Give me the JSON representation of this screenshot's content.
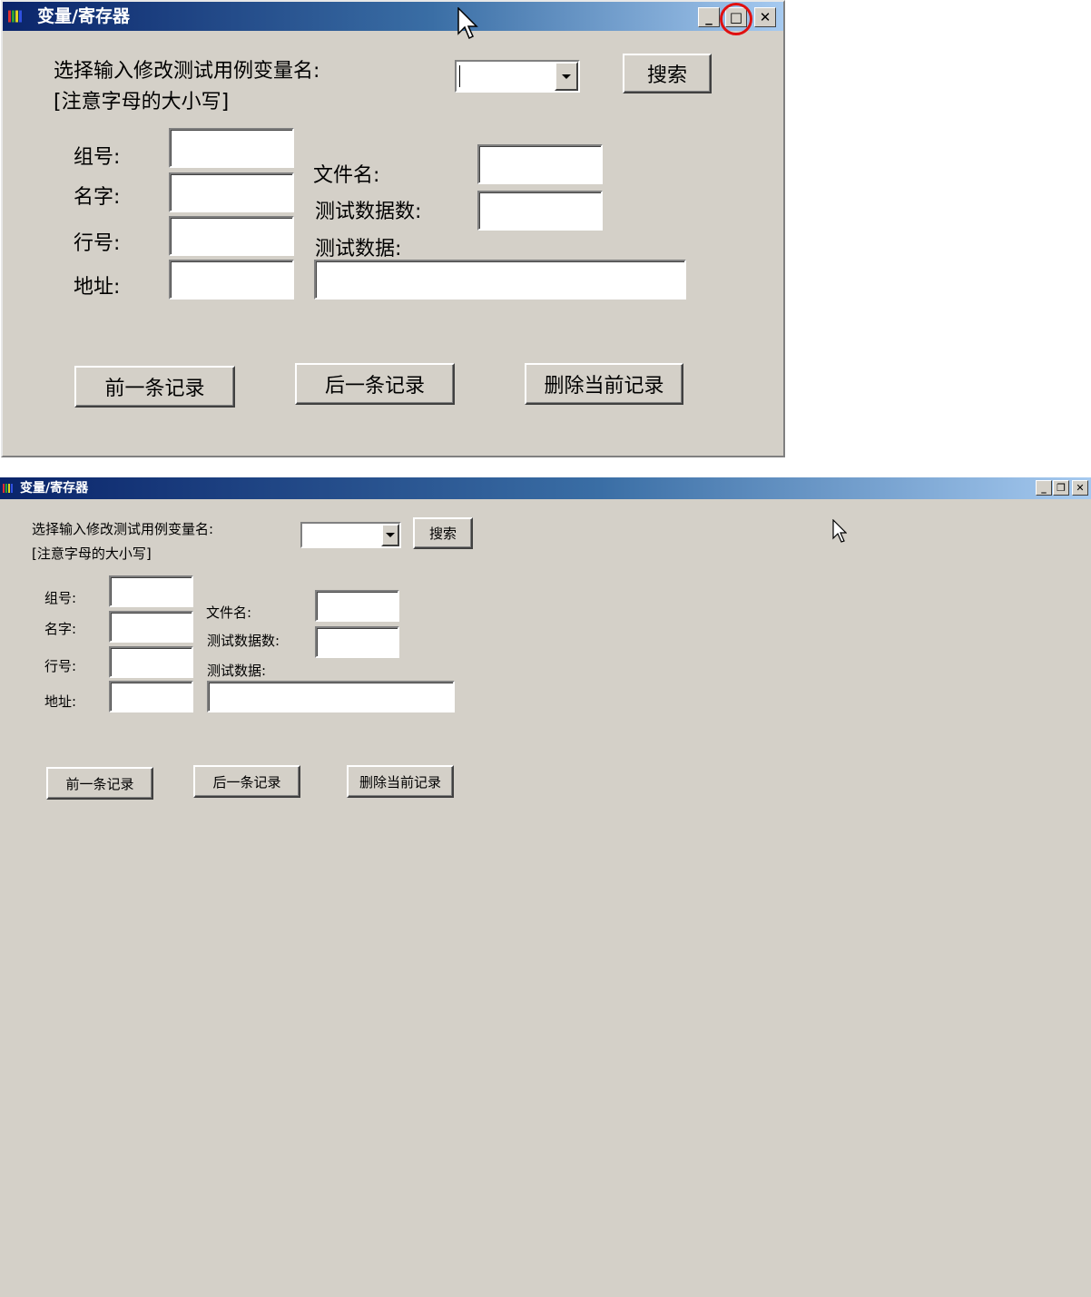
{
  "window_maximized_before": {
    "title": "变量/寄存器",
    "caption_buttons": {
      "minimize": "_",
      "maximize": "□",
      "close": "✕"
    },
    "highlighted_control": "maximize-button",
    "highlight_color": "#e01010",
    "prompt_line1": "选择输入修改测试用例变量名:",
    "prompt_line2": "[注意字母的大小写]",
    "variable_select": {
      "value": ""
    },
    "search_button": "搜索",
    "labels": {
      "group": "组号:",
      "name": "名字:",
      "line": "行号:",
      "address": "地址:",
      "filename": "文件名:",
      "test_count": "测试数据数:",
      "test_data": "测试数据:"
    },
    "fields": {
      "group": "",
      "name": "",
      "line": "",
      "address": "",
      "filename": "",
      "test_count": "",
      "test_data": ""
    },
    "buttons": {
      "prev": "前一条记录",
      "next": "后一条记录",
      "delete": "删除当前记录"
    }
  },
  "window_maximized_after": {
    "title": "变量/寄存器",
    "caption_buttons": {
      "minimize": "_",
      "restore": "❐",
      "close": "✕"
    },
    "prompt_line1": "选择输入修改测试用例变量名:",
    "prompt_line2": "[注意字母的大小写]",
    "variable_select": {
      "value": ""
    },
    "search_button": "搜索",
    "labels": {
      "group": "组号:",
      "name": "名字:",
      "line": "行号:",
      "address": "地址:",
      "filename": "文件名:",
      "test_count": "测试数据数:",
      "test_data": "测试数据:"
    },
    "fields": {
      "group": "",
      "name": "",
      "line": "",
      "address": "",
      "filename": "",
      "test_count": "",
      "test_data": ""
    },
    "buttons": {
      "prev": "前一条记录",
      "next": "后一条记录",
      "delete": "删除当前记录"
    }
  },
  "colors": {
    "face": "#d4d0c8",
    "title_start": "#0a246a",
    "title_end": "#a6caf0"
  }
}
